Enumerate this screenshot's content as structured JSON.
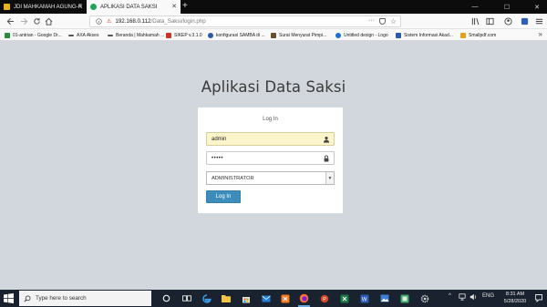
{
  "browser": {
    "tabs": [
      {
        "label": "JDI MAHKAMAH AGUNG-R"
      },
      {
        "label": "APLIKASI DATA SAKSI"
      }
    ],
    "new_tab_label": "+",
    "window_controls": {
      "minimize": "—",
      "maximize": "☐",
      "close": "✕"
    },
    "url": {
      "host": "192.168.0.112",
      "path": "/Data_Saksi/login.php"
    },
    "page_actions_label": "···",
    "bookmarks": [
      {
        "label": "01-antrian - Google Dr...",
        "color": "#2a8c3f"
      },
      {
        "label": "AXA Akses",
        "color": "#555555"
      },
      {
        "label": "Beranda | Mahkamah ...",
        "color": "#555555"
      },
      {
        "label": "SIKEP v.3.1.0",
        "color": "#c9352b"
      },
      {
        "label": "konfigurasi SAMBA di ...",
        "color": "#2d5aa8"
      },
      {
        "label": "Surat Menyurat Pimpi...",
        "color": "#6b4f2a"
      },
      {
        "label": "Untitled design - Logo",
        "color": "#1e6fd9"
      },
      {
        "label": "Sistem Informasi Akad...",
        "color": "#2d5aa8"
      },
      {
        "label": "Smallpdf.com",
        "color": "#e9a114"
      }
    ],
    "bookmarks_more": "»"
  },
  "page": {
    "title": "Aplikasi Data Saksi",
    "login": {
      "heading": "Log In",
      "username_value": "admin",
      "password_value": "•••••",
      "role_selected": "ADMINISTRATOR",
      "submit_label": "Log In"
    }
  },
  "taskbar": {
    "search_placeholder": "Type here to search",
    "tray": {
      "chevron": "^",
      "language": "ENG",
      "time": "8:31 AM",
      "date": "5/28/2020"
    }
  },
  "colors": {
    "page_background": "#d2d6dd",
    "accent_button": "#3c8dbc",
    "autofill_background": "#fcf5cc",
    "taskbar": "#1a2230"
  }
}
